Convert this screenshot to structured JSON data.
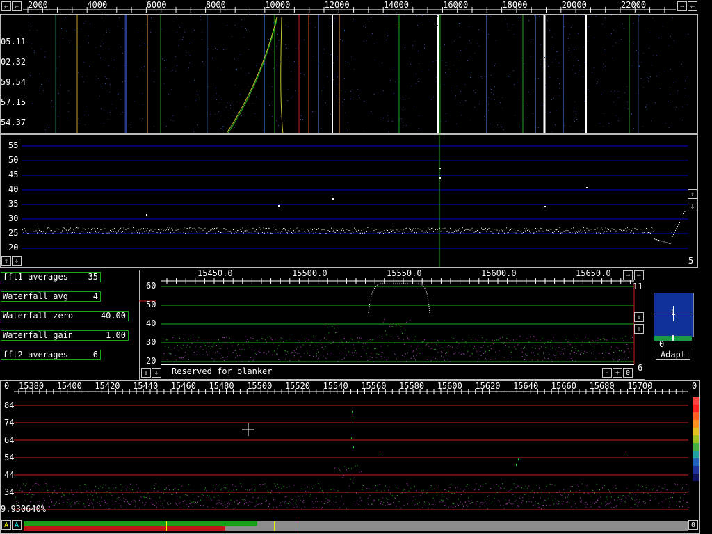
{
  "top_axis": {
    "freq_labels": [
      "2000",
      "4000",
      "6000",
      "8000",
      "10000",
      "12000",
      "14000",
      "16000",
      "18000",
      "20000",
      "22000"
    ],
    "nav_left_1": "⇐",
    "nav_left_2": "⇐",
    "nav_right_1": "⇒",
    "nav_right_2": "⇐"
  },
  "waterfall": {
    "time_labels": [
      "05.11",
      "02.32",
      "59.54",
      "57.15",
      "54.37"
    ]
  },
  "spectrum1": {
    "y_labels": [
      "55",
      "50",
      "45",
      "40",
      "35",
      "30",
      "25",
      "20"
    ],
    "corner_value": "5"
  },
  "params": [
    {
      "label": "fft1 averages",
      "value": "35"
    },
    {
      "label": "Waterfall avg",
      "value": "4"
    },
    {
      "label": "Waterfall zero",
      "value": "40.00"
    },
    {
      "label": "Waterfall gain",
      "value": "1.00"
    },
    {
      "label": "fft2 averages",
      "value": "6"
    }
  ],
  "spectrum2": {
    "freq_labels": [
      "15450.0",
      "15500.0",
      "15550.0",
      "15600.0",
      "15650.0"
    ],
    "y_labels": [
      "60",
      "50",
      "40",
      "30",
      "20"
    ],
    "right_top": "11",
    "right_bottom": "6",
    "reserved_text": "Reserved for blanker",
    "minus": "-",
    "plus": "+",
    "zero": "0"
  },
  "afc": {
    "marker": "L",
    "value": "0",
    "adapt_label": "Adapt"
  },
  "baseband": {
    "freq_labels": [
      "15380",
      "15400",
      "15420",
      "15440",
      "15460",
      "15480",
      "15500",
      "15520",
      "15540",
      "15560",
      "15580",
      "15600",
      "15620",
      "15640",
      "15660",
      "15680",
      "15700"
    ],
    "y_labels": [
      "84",
      "74",
      "64",
      "54",
      "44",
      "34"
    ],
    "left_value": "0",
    "right_value": "0",
    "percent": "9.930640%",
    "bottom_right_value": "0",
    "btn_a1": "A",
    "btn_a2": "A"
  },
  "colors": {
    "grid_blue": "#0000c8",
    "grid_green": "#22aa22",
    "grid_red": "#c81e1e",
    "param_border": "#1aa81a"
  }
}
